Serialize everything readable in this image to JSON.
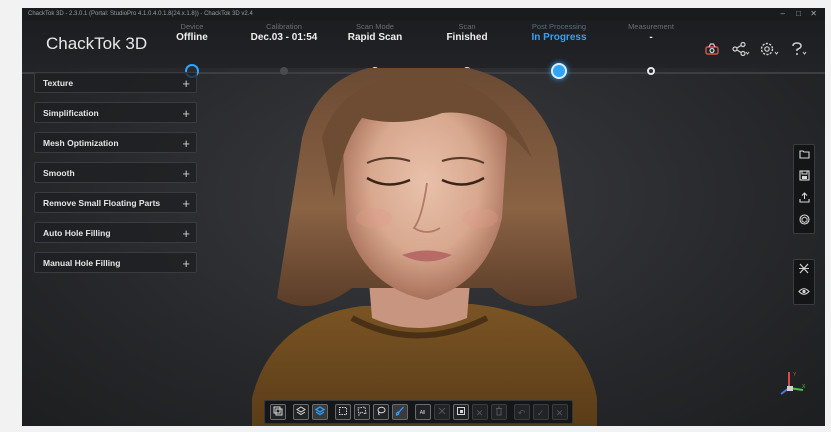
{
  "titlebar": {
    "text": "ChackTok 3D - 2.3.0.1 (Portal: StudioPro 4.1.0.4.0.1.8(24.x.1.8)) - ChackTok 3D v2.4"
  },
  "header": {
    "app_name": "ChackTok 3D",
    "steps": [
      {
        "label": "Device",
        "value": "Offline"
      },
      {
        "label": "Calibration",
        "value": "Dec.03 - 01:54"
      },
      {
        "label": "Scan Mode",
        "value": "Rapid Scan"
      },
      {
        "label": "Scan",
        "value": "Finished"
      },
      {
        "label": "Post Processing",
        "value": "In Progress"
      },
      {
        "label": "Measurement",
        "value": "-"
      }
    ],
    "icons": [
      "scanner-icon",
      "share-icon",
      "settings-icon",
      "help-icon"
    ]
  },
  "post_processing_panel": {
    "items": [
      {
        "label": "Texture"
      },
      {
        "label": "Simplification"
      },
      {
        "label": "Mesh Optimization"
      },
      {
        "label": "Smooth"
      },
      {
        "label": "Remove Small Floating Parts"
      },
      {
        "label": "Auto Hole Filling"
      },
      {
        "label": "Manual Hole Filling"
      }
    ],
    "expand_glyph": "+"
  },
  "right_toolbar": {
    "group1": [
      "folder-icon",
      "save-icon",
      "export-icon",
      "model-icon"
    ],
    "group2": [
      "fit-view-icon",
      "visibility-icon"
    ]
  },
  "bottom_toolbar": {
    "buttons": [
      "layer-icon",
      "layers-icon",
      "layers-active-icon",
      "rect-select-icon",
      "poly-select-icon",
      "lasso-select-icon",
      "brush-select-icon",
      "select-all-icon",
      "invert-select-icon",
      "crop-icon",
      "clear-icon",
      "delete-icon",
      "undo-icon",
      "apply-icon",
      "cancel-icon"
    ],
    "all_label": "All"
  },
  "axis": {
    "y": "Y",
    "x": "X",
    "z": "Z"
  },
  "colors": {
    "accent": "#2ea4ff",
    "background": "#2b2c2f"
  }
}
